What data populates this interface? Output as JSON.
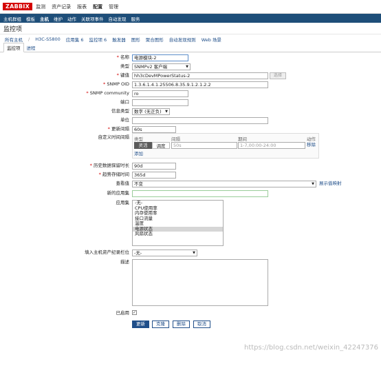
{
  "logo": "ZABBIX",
  "main_menu": [
    "监测",
    "资产记录",
    "报表",
    "配置",
    "管理"
  ],
  "sub_menu": [
    "主机群组",
    "模板",
    "主机",
    "维护",
    "动作",
    "关联项事件",
    "自动发现",
    "服务"
  ],
  "page_title": "监控项",
  "crumbs": [
    "所有主机",
    "H3C-S5800",
    "应用集 6",
    "监控项 6",
    "触发器",
    "图形",
    "聚合图形",
    "自动发现规则",
    "Web 场景"
  ],
  "tabs": [
    "监控项",
    "进程"
  ],
  "labels": {
    "name": "名称",
    "type": "类型",
    "key": "键值",
    "oid": "SNMP OID",
    "community": "SNMP community",
    "port": "端口",
    "info_type": "信息类型",
    "unit": "单位",
    "interval": "更新间隔",
    "custom": "自定义时间间隔",
    "history": "历史数据保留时长",
    "trend": "趋势存储时间",
    "show_value": "查看值",
    "new_app": "新的应用集",
    "apps": "应用集",
    "inventory": "填入主机资产纪录栏位",
    "desc": "描述",
    "enabled": "已启用"
  },
  "values": {
    "name": "电源模块-2",
    "type": "SNMPv2 客户端",
    "key": "hh3cDevMPowerStatus-2",
    "oid": "1.3.6.1.4.1.25506.8.35.9.1.2.1.2.2",
    "community": "ro",
    "port": "",
    "info_type": "数字 (无正负)",
    "unit": "",
    "interval": "60s",
    "history": "90d",
    "trend": "365d",
    "show_value": "不变",
    "new_app": "",
    "inventory": "-无-",
    "desc": ""
  },
  "select_btn": "选择",
  "custom_table": {
    "headers": [
      "类型",
      "间隔",
      "期间",
      "动作"
    ],
    "toggle": [
      "灵活",
      "调度"
    ],
    "interval_ph": "50s",
    "period_ph": "1-7,00:00-24:00",
    "remove": "移除",
    "add": "添加"
  },
  "show_value_link": "展示值映射",
  "app_list": [
    "-无-",
    "CPU使用率",
    "内存使用率",
    "接口流量",
    "温度",
    "电源状态",
    "风扇状态"
  ],
  "buttons": [
    "更新",
    "克隆",
    "删除",
    "取消"
  ],
  "watermark": "https://blog.csdn.net/weixin_42247376",
  "colors": {
    "logo": "#d40000",
    "nav": "#1e4e79",
    "link": "#1f4e89"
  }
}
